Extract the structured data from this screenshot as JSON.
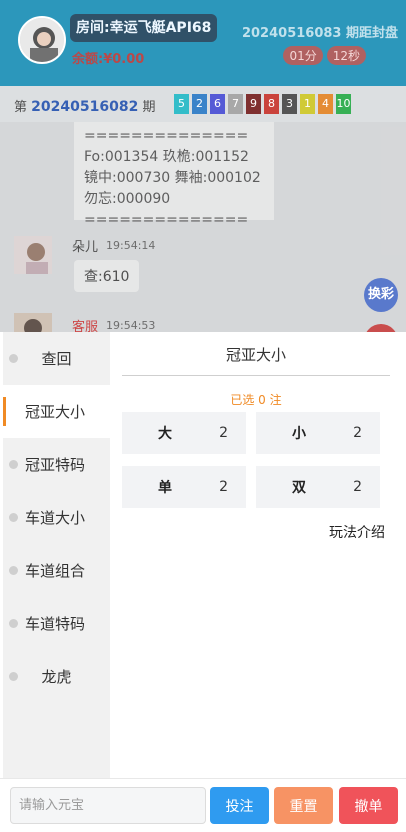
{
  "header": {
    "room_title": "房间:幸运飞艇API68",
    "balance": "余额:¥0.00",
    "next_period": "20240516083 期距封盘",
    "countdown_min": "01分",
    "countdown_sec": "12秒"
  },
  "issue": {
    "prefix": "第",
    "number": "20240516082",
    "suffix": "期",
    "balls": [
      {
        "n": "5",
        "color": "#12b3c1"
      },
      {
        "n": "2",
        "color": "#1a6fc0"
      },
      {
        "n": "6",
        "color": "#3a3fd0"
      },
      {
        "n": "7",
        "color": "#9a9a9a"
      },
      {
        "n": "9",
        "color": "#6a0e0e"
      },
      {
        "n": "8",
        "color": "#c2251d"
      },
      {
        "n": "3",
        "color": "#3a3a3a"
      },
      {
        "n": "1",
        "color": "#c9c215"
      },
      {
        "n": "4",
        "color": "#e07a13"
      },
      {
        "n": "10",
        "color": "#17a33a"
      }
    ]
  },
  "chat": {
    "card_text": "==============\nFo:001354 玖桅:001152\n镜中:000730 舞袖:000102\n勿忘:000090\n==============",
    "msg1_name": "朵儿",
    "msg1_time": "19:54:14",
    "msg1_text": "查:610",
    "msg2_name": "客服",
    "msg2_time": "19:54:53",
    "float_switch": "换彩"
  },
  "sidebar": {
    "items": [
      {
        "label": "查回"
      },
      {
        "label": "冠亚大小"
      },
      {
        "label": "冠亚特码"
      },
      {
        "label": "车道大小"
      },
      {
        "label": "车道组合"
      },
      {
        "label": "车道特码"
      },
      {
        "label": "龙虎"
      }
    ]
  },
  "panel": {
    "title": "冠亚大小",
    "selected_text": "已选 0 注",
    "options": [
      {
        "name": "大",
        "odds": "2"
      },
      {
        "name": "小",
        "odds": "2"
      },
      {
        "name": "单",
        "odds": "2"
      },
      {
        "name": "双",
        "odds": "2"
      }
    ],
    "rules_link": "玩法介绍"
  },
  "footer": {
    "amount_placeholder": "请输入元宝",
    "bet_label": "投注",
    "reset_label": "重置",
    "cancel_label": "撤单",
    "colors": {
      "bet": "#2f9bf0",
      "reset": "#f79364",
      "cancel": "#f0535a"
    }
  }
}
